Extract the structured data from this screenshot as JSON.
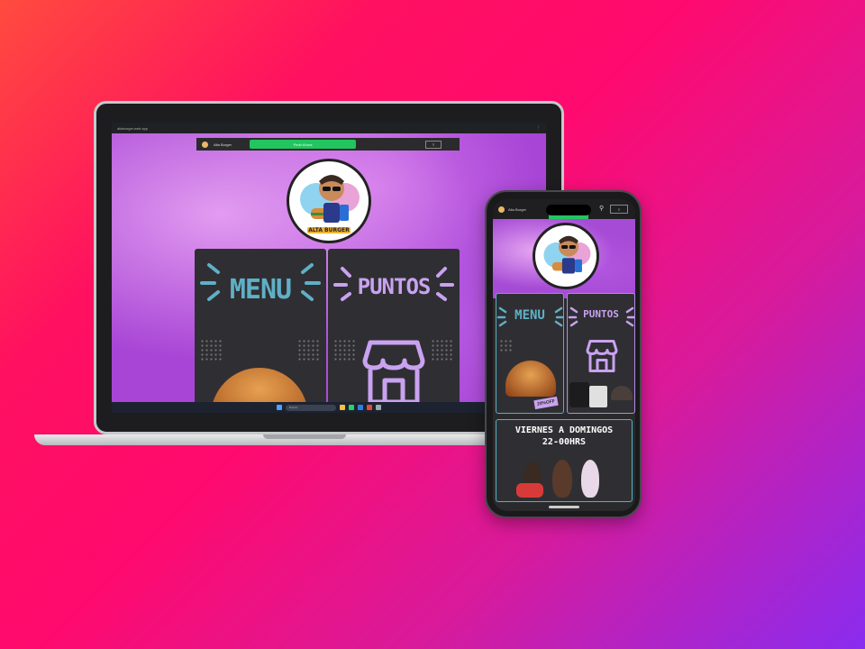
{
  "browser": {
    "url": "altaburger.web.app",
    "controls": "⋮"
  },
  "site": {
    "nav": {
      "brand": "Alta Burger",
      "cta_label": "Pedir Ahora",
      "menu_label": "≡"
    },
    "logo_text": "ALTA BURGER",
    "tiles": [
      {
        "label": "MENU"
      },
      {
        "label": "PUNTOS"
      }
    ],
    "banner": {
      "line1": "VIERNES A DOMINGOS",
      "line2": "22-00HRS"
    },
    "badge": "20%OFF"
  },
  "taskbar": {
    "search_placeholder": "Buscar"
  },
  "colors": {
    "accent_green": "#22c55e",
    "menu_teal": "#5fb0c6",
    "puntos_lilac": "#c9a2f0",
    "tile_dark": "#2f2f33",
    "hero_purple": "#a845d6"
  }
}
